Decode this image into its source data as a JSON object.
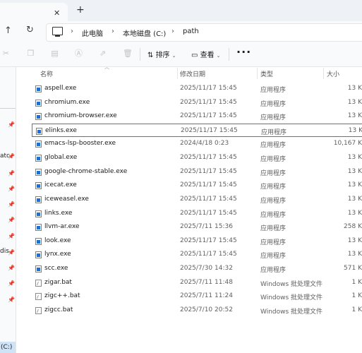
{
  "tabbar": {
    "close_glyph": "✕",
    "new_tab_glyph": "+"
  },
  "addressbar": {
    "up_glyph": "↑",
    "refresh_glyph": "↻",
    "separator": "›",
    "breadcrumbs": [
      "此电脑",
      "本地磁盘 (C:)",
      "path"
    ]
  },
  "commandbar": {
    "sort_label": "排序",
    "view_label": "查看",
    "more_label": "···",
    "caret": "⌄"
  },
  "navpane": {
    "fragments": [
      "atc",
      "dis",
      "(C:)"
    ]
  },
  "columns": {
    "name": "名称",
    "modified": "修改日期",
    "type": "类型",
    "size": "大小"
  },
  "files": [
    {
      "name": "aspell.exe",
      "date": "2025/11/17 15:45",
      "type": "应用程序",
      "size": "13 K",
      "kind": "exe"
    },
    {
      "name": "chromium.exe",
      "date": "2025/11/17 15:45",
      "type": "应用程序",
      "size": "13 K",
      "kind": "exe"
    },
    {
      "name": "chromium-browser.exe",
      "date": "2025/11/17 15:45",
      "type": "应用程序",
      "size": "13 K",
      "kind": "exe"
    },
    {
      "name": "elinks.exe",
      "date": "2025/11/17 15:45",
      "type": "应用程序",
      "size": "13 K",
      "kind": "exe"
    },
    {
      "name": "emacs-lsp-booster.exe",
      "date": "2024/4/18 0:23",
      "type": "应用程序",
      "size": "10,167 K",
      "kind": "exe"
    },
    {
      "name": "global.exe",
      "date": "2025/11/17 15:45",
      "type": "应用程序",
      "size": "13 K",
      "kind": "exe"
    },
    {
      "name": "google-chrome-stable.exe",
      "date": "2025/11/17 15:45",
      "type": "应用程序",
      "size": "13 K",
      "kind": "exe"
    },
    {
      "name": "icecat.exe",
      "date": "2025/11/17 15:45",
      "type": "应用程序",
      "size": "13 K",
      "kind": "exe"
    },
    {
      "name": "iceweasel.exe",
      "date": "2025/11/17 15:45",
      "type": "应用程序",
      "size": "13 K",
      "kind": "exe"
    },
    {
      "name": "links.exe",
      "date": "2025/11/17 15:45",
      "type": "应用程序",
      "size": "13 K",
      "kind": "exe"
    },
    {
      "name": "llvm-ar.exe",
      "date": "2025/7/11 15:36",
      "type": "应用程序",
      "size": "258 K",
      "kind": "exe"
    },
    {
      "name": "look.exe",
      "date": "2025/11/17 15:45",
      "type": "应用程序",
      "size": "13 K",
      "kind": "exe"
    },
    {
      "name": "lynx.exe",
      "date": "2025/11/17 15:45",
      "type": "应用程序",
      "size": "13 K",
      "kind": "exe"
    },
    {
      "name": "scc.exe",
      "date": "2025/7/30 14:32",
      "type": "应用程序",
      "size": "571 K",
      "kind": "exe"
    },
    {
      "name": "zigar.bat",
      "date": "2025/7/11 11:48",
      "type": "Windows 批处理文件",
      "size": "1 K",
      "kind": "bat"
    },
    {
      "name": "zigc++.bat",
      "date": "2025/7/11 11:24",
      "type": "Windows 批处理文件",
      "size": "1 K",
      "kind": "bat"
    },
    {
      "name": "zigcc.bat",
      "date": "2025/7/10 20:52",
      "type": "Windows 批处理文件",
      "size": "1 K",
      "kind": "bat"
    }
  ]
}
